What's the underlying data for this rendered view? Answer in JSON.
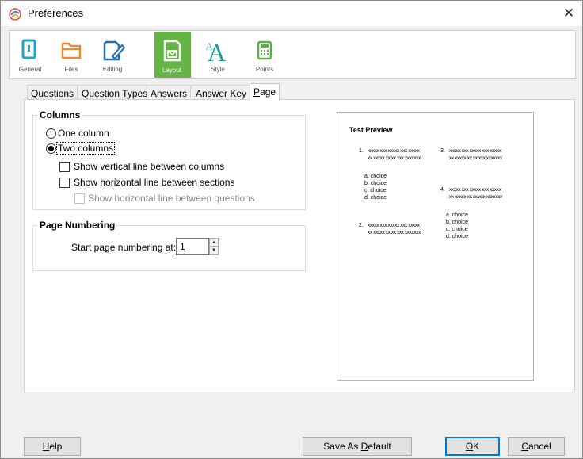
{
  "window": {
    "title": "Preferences",
    "close_label": "✕"
  },
  "toolbar": {
    "items": [
      {
        "label": "General",
        "icon": "general-icon",
        "color": "#1aa7c9"
      },
      {
        "label": "Files",
        "icon": "folder-icon",
        "color": "#f08a24"
      },
      {
        "label": "Editing",
        "icon": "document-edit-icon",
        "color": "#1f6fb2"
      },
      {
        "label": "Layout",
        "icon": "layout-icon",
        "color": "#ffffff",
        "active": true,
        "active_bg": "#64b446"
      },
      {
        "label": "Style",
        "icon": "style-font-icon",
        "color": "#1aa192"
      },
      {
        "label": "Points",
        "icon": "calculator-icon",
        "color": "#5bb142"
      }
    ]
  },
  "tabs": [
    {
      "label": "Questions",
      "mnemonic": "Q"
    },
    {
      "label": "Question Types",
      "mnemonic": "T"
    },
    {
      "label": "Answers",
      "mnemonic": "A"
    },
    {
      "label": "Answer Key",
      "mnemonic": "K"
    },
    {
      "label": "Page",
      "mnemonic": "P",
      "active": true
    }
  ],
  "columns": {
    "title": "Columns",
    "one_column": "One column",
    "two_columns": "Two columns",
    "selected": "two_columns",
    "vertical_line": "Show vertical line between columns",
    "horizontal_line_sections": "Show horizontal line between sections",
    "horizontal_line_questions": "Show horizontal line between questions"
  },
  "page_numbering": {
    "title": "Page Numbering",
    "start_label": "Start page numbering at:",
    "start_value": "1"
  },
  "preview": {
    "title": "Test Preview",
    "questions": [
      {
        "num": "1.",
        "text": "xxxxx xxx xxxxx xxx xxxxx xx xxxxx xx xx xxx xxxxxxx",
        "choices": [
          "a.  choice",
          "b.  choice",
          "c.  choice",
          "d.  choice"
        ]
      },
      {
        "num": "2.",
        "text": "xxxxx xxx xxxxx xxx xxxxx xx xxxxx xx xx xxx xxxxxxx",
        "choices": []
      },
      {
        "num": "3.",
        "text": "xxxxx xxx xxxxx xxx xxxxx xx xxxxx xx xx xxx xxxxxxx",
        "choices": []
      },
      {
        "num": "4.",
        "text": "xxxxx xxx xxxxx xxx xxxxx xx xxxxx xx xx xxx xxxxxxx",
        "choices": [
          "a.  choice",
          "b.  choice",
          "c.  choice",
          "d.  choice"
        ]
      }
    ]
  },
  "buttons": {
    "help": "Help",
    "save_default": "Save As Default",
    "ok": "OK",
    "cancel": "Cancel"
  }
}
